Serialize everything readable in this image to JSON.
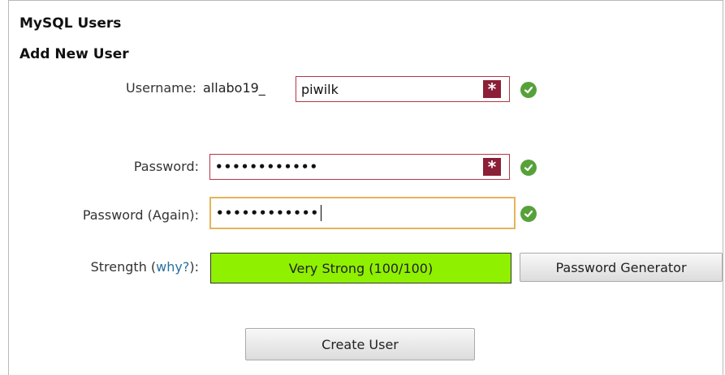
{
  "section_title": "MySQL Users",
  "subsection_title": "Add New User",
  "form": {
    "username": {
      "label": "Username:",
      "prefix": "allabo19_",
      "value": "piwilk",
      "required_icon": "asterisk-icon",
      "status_icon": "check-icon"
    },
    "password": {
      "label": "Password:",
      "masked_value": "••••••••••••",
      "required_icon": "asterisk-icon",
      "status_icon": "check-icon"
    },
    "password_again": {
      "label": "Password (Again):",
      "masked_value": "••••••••••••",
      "status_icon": "check-icon"
    },
    "strength": {
      "label_prefix": "Strength (",
      "why_link": "why?",
      "label_suffix": "):",
      "meter_text": "Very Strong (100/100)",
      "meter_color": "#8ff000",
      "score": 100
    },
    "password_generator_label": "Password Generator",
    "create_user_label": "Create User"
  },
  "colors": {
    "required_red": "#8b1f37",
    "success_green": "#57a13b",
    "focus_border": "#e7b35a",
    "link_blue": "#2a6fa0"
  }
}
